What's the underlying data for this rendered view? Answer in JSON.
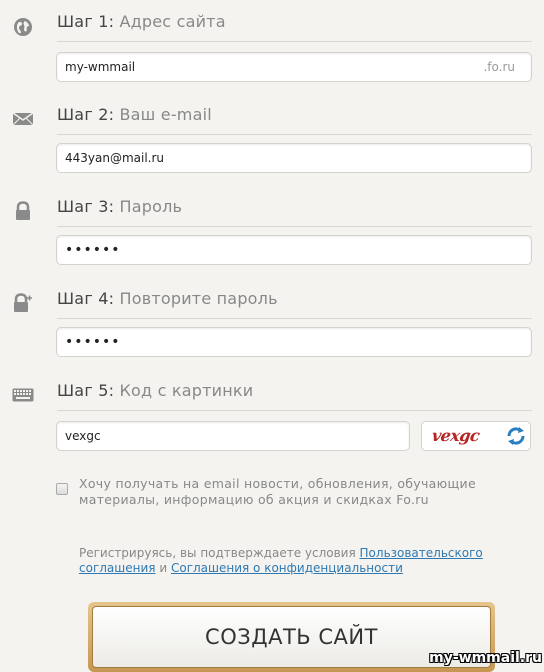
{
  "steps": [
    {
      "num": "Шаг 1:",
      "title": "Адрес сайта",
      "icon": "globe-icon"
    },
    {
      "num": "Шаг 2:",
      "title": "Ваш e-mail",
      "icon": "envelope-icon"
    },
    {
      "num": "Шаг 3:",
      "title": "Пароль",
      "icon": "lock-icon"
    },
    {
      "num": "Шаг 4:",
      "title": "Повторите пароль",
      "icon": "lock-icon"
    },
    {
      "num": "Шаг 5:",
      "title": "Код с картинки",
      "icon": "keyboard-icon"
    }
  ],
  "fields": {
    "site_value": "my-wmmail",
    "site_suffix": ".fo.ru",
    "email_value": "443yan@mail.ru",
    "password_value": "111111",
    "password_confirm_value": "111111",
    "captcha_value": "vexgc"
  },
  "captcha": {
    "image_text": "vexgc"
  },
  "newsletter": {
    "label": "Хочу получать на email новости, обновления, обучающие материалы, информацию об акция и скидках Fo.ru",
    "checked": false
  },
  "terms": {
    "prefix": "Регистрируясь, вы подтверждаете условия",
    "link1": "Пользовательского соглашения",
    "and": "и",
    "link2": "Соглашения о конфиденциальности"
  },
  "submit_label": "СОЗДАТЬ САЙТ",
  "watermark": "my-wmmail.ru"
}
